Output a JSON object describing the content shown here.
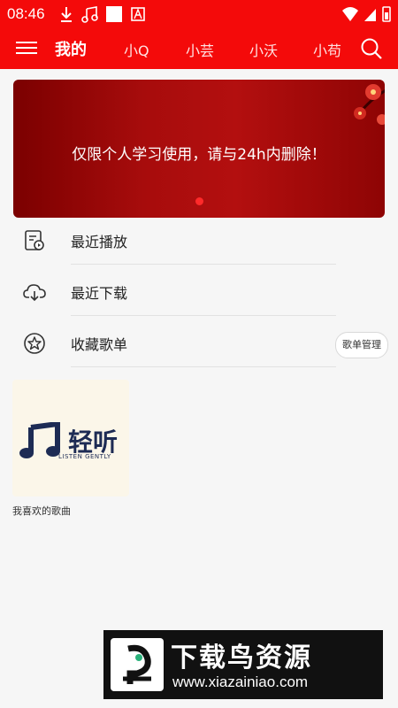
{
  "status_bar": {
    "time": "08:46"
  },
  "header": {
    "tabs": [
      {
        "label": "我的",
        "active": true
      },
      {
        "label": "小Q"
      },
      {
        "label": "小芸"
      },
      {
        "label": "小沃"
      },
      {
        "label": "小苟"
      }
    ]
  },
  "banner": {
    "text": "仅限个人学习使用，请与24h内删除！"
  },
  "menu": {
    "recent_play": "最近播放",
    "recent_download": "最近下载",
    "favorites": "收藏歌单",
    "manage_label": "歌单管理"
  },
  "playlist": {
    "cover_title": "轻听",
    "cover_subtitle": "LISTEN GENTLY",
    "name": "我喜欢的歌曲"
  },
  "watermark": {
    "title": "下载鸟资源",
    "url": "www.xiazainiao.com"
  },
  "colors": {
    "accent": "#f40a0a"
  }
}
